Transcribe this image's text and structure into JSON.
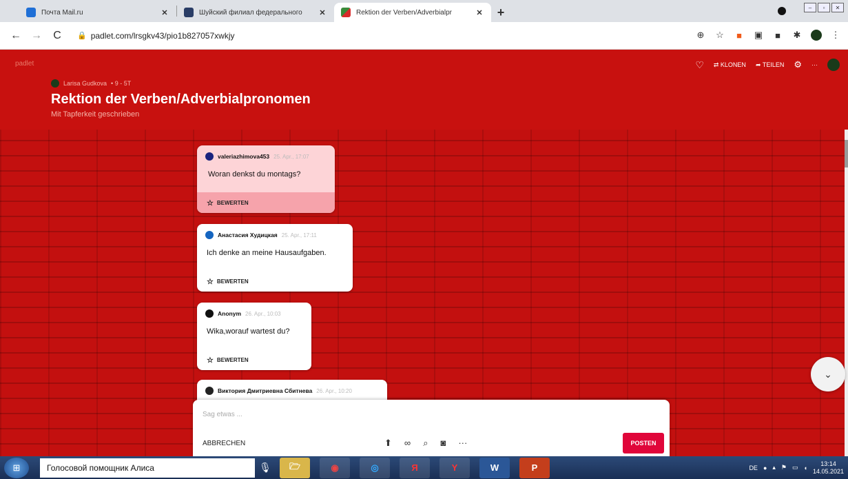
{
  "browser": {
    "tabs": [
      {
        "title": "Почта Mail.ru",
        "favicon_color": "#1f6fd6",
        "active": false
      },
      {
        "title": "Шуйский филиал федерального",
        "favicon_color": "#2a3d66",
        "active": false
      },
      {
        "title": "Rektion der Verben/Adverbialpr",
        "favicon_color": "#3a8a3a",
        "active": true
      }
    ],
    "new_tab": "+",
    "url": "padlet.com/lrsgkv43/pio1b827057xwkjy"
  },
  "padlet": {
    "logo": "padlet",
    "actions": {
      "clone": "KLONEN",
      "share": "TEILEN"
    },
    "author": "Larisa Gudkova",
    "author_meta": "• 9 - 5T",
    "title": "Rektion der Verben/Adverbialpronomen",
    "subtitle": "Mit Tapferkeit geschrieben",
    "rate_label": "BEWERTEN",
    "posts": [
      {
        "author": "valeriazhimova453",
        "time": "25. Apr., 17:07",
        "text": "Woran denkst du montags?",
        "avatar_color": "#1a237e"
      },
      {
        "author": "Анастасия Худицкая",
        "time": "25. Apr., 17:11",
        "text": "Ich denke an meine Hausaufgaben.",
        "avatar_color": "#1565c0"
      },
      {
        "author": "Anonym",
        "time": "26. Apr., 10:03",
        "text": "Wika,worauf wartest du?",
        "avatar_color": "#111111"
      },
      {
        "author": "Виктория Дмитриевна Сбитнева",
        "time": "26. Apr., 10:20",
        "text": "",
        "avatar_color": "#222222"
      }
    ],
    "composer": {
      "placeholder": "Sag etwas ...",
      "cancel": "ABBRECHEN",
      "post": "POSTEN"
    }
  },
  "taskbar": {
    "assistant": "Голосовой помощник Алиса",
    "apps": [
      "🗁",
      "◉",
      "◎",
      "Я",
      "Y",
      "W",
      "P"
    ],
    "lang": "DE",
    "time": "13:14",
    "date": "14.05.2021"
  }
}
